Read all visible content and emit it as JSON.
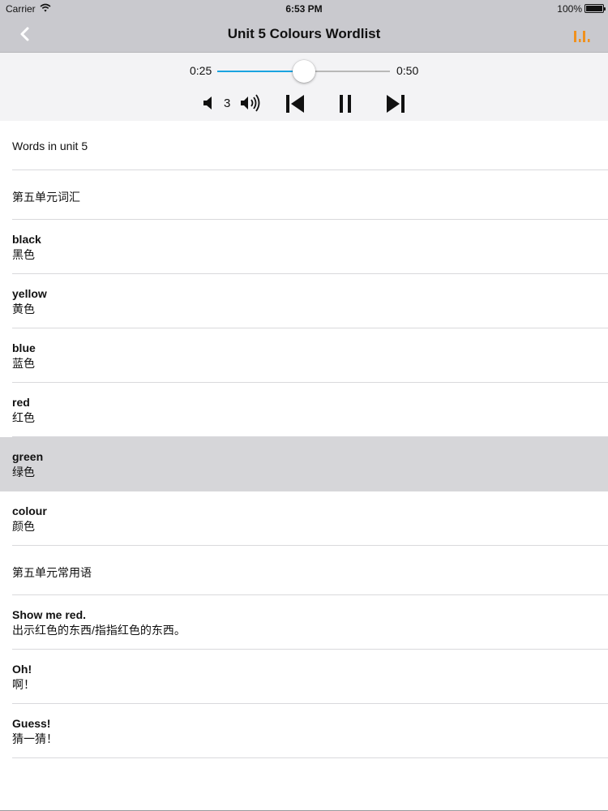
{
  "status_bar": {
    "carrier": "Carrier",
    "time": "6:53 PM",
    "battery": "100%",
    "icons": [
      "wifi-icon",
      "battery-icon"
    ]
  },
  "nav": {
    "title": "Unit 5 Colours Wordlist",
    "back_icon": "chevron-left-icon",
    "right_icon": "levels-icon",
    "accent_color": "#f0911e"
  },
  "player": {
    "current_time": "0:25",
    "total_time": "0:50",
    "progress": 0.5,
    "volume": "3",
    "track_color": "#1aa3e0",
    "controls": [
      "volume-down-icon",
      "volume-up-icon",
      "previous-icon",
      "pause-icon",
      "next-icon"
    ]
  },
  "list": {
    "items": [
      {
        "type": "single",
        "text": "Words in unit 5"
      },
      {
        "type": "single",
        "text": "第五单元词汇"
      },
      {
        "type": "double",
        "en": "black",
        "zh": "黑色"
      },
      {
        "type": "double",
        "en": "yellow",
        "zh": "黄色"
      },
      {
        "type": "double",
        "en": "blue",
        "zh": "蓝色"
      },
      {
        "type": "double",
        "en": "red",
        "zh": "红色"
      },
      {
        "type": "double",
        "en": "green",
        "zh": "绿色",
        "selected": true
      },
      {
        "type": "double",
        "en": "colour",
        "zh": "颜色"
      },
      {
        "type": "single",
        "text": "第五单元常用语"
      },
      {
        "type": "double",
        "en": "Show me red.",
        "zh": "出示红色的东西/指指红色的东西。"
      },
      {
        "type": "double",
        "en": "Oh!",
        "zh": "啊！"
      },
      {
        "type": "double",
        "en": "Guess!",
        "zh": "猜一猜！"
      }
    ]
  }
}
